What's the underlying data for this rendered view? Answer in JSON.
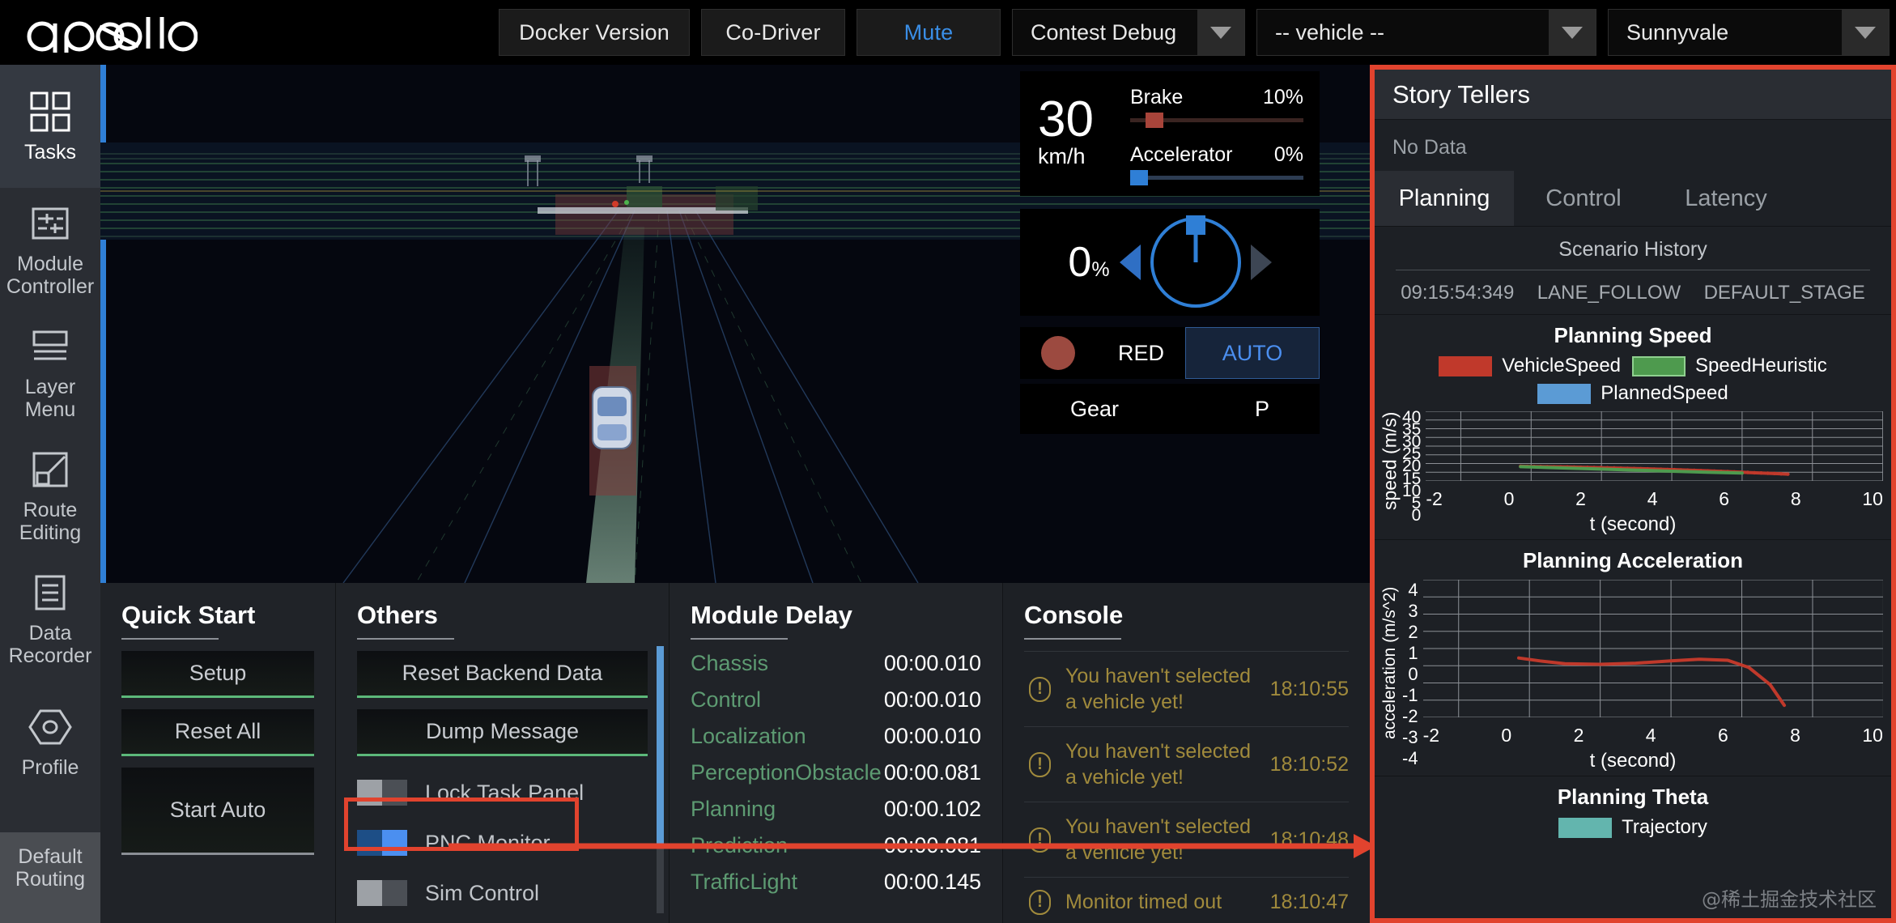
{
  "app": {
    "logo_text": "apollo"
  },
  "header": {
    "buttons": [
      {
        "label": "Docker Version",
        "accent": false
      },
      {
        "label": "Co-Driver",
        "accent": false
      },
      {
        "label": "Mute",
        "accent": true
      }
    ],
    "selects": [
      {
        "name": "mode-select",
        "value": "Contest Debug"
      },
      {
        "name": "vehicle-select",
        "value": "-- vehicle --"
      },
      {
        "name": "map-select",
        "value": "Sunnyvale"
      }
    ]
  },
  "sidebar": {
    "items": [
      {
        "label": "Tasks",
        "icon": "grid-icon",
        "active": true
      },
      {
        "label": "Module\nController",
        "icon": "sliders-icon",
        "active": false
      },
      {
        "label": "Layer\nMenu",
        "icon": "layers-icon",
        "active": false
      },
      {
        "label": "Route\nEditing",
        "icon": "route-icon",
        "active": false
      },
      {
        "label": "Data\nRecorder",
        "icon": "document-icon",
        "active": false
      },
      {
        "label": "Profile",
        "icon": "hexagon-eye-icon",
        "active": false
      }
    ],
    "bottom_item": {
      "label": "Default",
      "sub_label": "Routing"
    }
  },
  "hud": {
    "speed": {
      "value": "30",
      "unit": "km/h"
    },
    "brake": {
      "label": "Brake",
      "value": "10%",
      "percent": 10,
      "color": "#a8443a"
    },
    "accelerator": {
      "label": "Accelerator",
      "value": "0%",
      "percent": 0,
      "color": "#2f7fd6"
    },
    "steering": {
      "value": "0",
      "unit": "%"
    },
    "traffic_light": {
      "label": "RED",
      "color": "#9c4a40"
    },
    "drive_mode": {
      "label": "AUTO"
    },
    "gear": {
      "label": "Gear",
      "value": "P"
    }
  },
  "quick_start": {
    "title": "Quick Start",
    "buttons": [
      {
        "label": "Setup",
        "style": "green"
      },
      {
        "label": "Reset All",
        "style": "green"
      },
      {
        "label": "Start Auto",
        "style": "tall"
      }
    ]
  },
  "others": {
    "title": "Others",
    "buttons": [
      {
        "label": "Reset Backend Data"
      },
      {
        "label": "Dump Message"
      }
    ],
    "toggles": [
      {
        "label": "Lock Task Panel",
        "on": false,
        "highlighted": false
      },
      {
        "label": "PNC Monitor",
        "on": true,
        "highlighted": true
      },
      {
        "label": "Sim Control",
        "on": false,
        "highlighted": false
      }
    ]
  },
  "module_delay": {
    "title": "Module Delay",
    "rows": [
      {
        "name": "Chassis",
        "value": "00:00.010"
      },
      {
        "name": "Control",
        "value": "00:00.010"
      },
      {
        "name": "Localization",
        "value": "00:00.010"
      },
      {
        "name": "PerceptionObstacle",
        "value": "00:00.081"
      },
      {
        "name": "Planning",
        "value": "00:00.102"
      },
      {
        "name": "Prediction",
        "value": "00:00.081"
      },
      {
        "name": "TrafficLight",
        "value": "00:00.145"
      }
    ]
  },
  "console": {
    "title": "Console",
    "entries": [
      {
        "icon": "warning-icon",
        "message": "You haven't selected a vehicle yet!",
        "time": "18:10:55"
      },
      {
        "icon": "warning-icon",
        "message": "You haven't selected a vehicle yet!",
        "time": "18:10:52"
      },
      {
        "icon": "warning-icon",
        "message": "You haven't selected a vehicle yet!",
        "time": "18:10:48"
      },
      {
        "icon": "warning-icon",
        "message": "Monitor timed out",
        "time": "18:10:47"
      }
    ]
  },
  "pnc_monitor": {
    "title": "Story Tellers",
    "no_data": "No Data",
    "tabs": [
      {
        "label": "Planning",
        "active": true
      },
      {
        "label": "Control",
        "active": false
      },
      {
        "label": "Latency",
        "active": false
      }
    ],
    "scenario_history": {
      "title": "Scenario History",
      "row": [
        "09:15:54:349",
        "LANE_FOLLOW",
        "DEFAULT_STAGE"
      ]
    },
    "theta_title": "Planning Theta",
    "theta_legend": "Trajectory"
  },
  "chart_data": [
    {
      "type": "line",
      "title": "Planning Speed",
      "xlabel": "t (second)",
      "ylabel": "speed (m/s)",
      "xlim": [
        -3,
        10
      ],
      "ylim": [
        0,
        40
      ],
      "xticks": [
        "-2",
        "0",
        "2",
        "4",
        "6",
        "8",
        "10"
      ],
      "yticks": [
        "40",
        "35",
        "30",
        "25",
        "20",
        "15",
        "10",
        "5",
        "0"
      ],
      "grid": true,
      "legend_position": "top",
      "series": [
        {
          "name": "VehicleSpeed",
          "color": "#c0392b",
          "x": [
            -0.3,
            0,
            1,
            2,
            3,
            4,
            5,
            6,
            7,
            7.3
          ],
          "y": [
            8.4,
            8.3,
            8.0,
            7.6,
            7.1,
            6.5,
            5.8,
            5.0,
            4.2,
            3.9
          ]
        },
        {
          "name": "SpeedHeuristic",
          "color": "#4e9a4e",
          "x": [
            -0.3,
            0,
            1,
            2,
            3,
            4,
            5,
            6
          ],
          "y": [
            8.2,
            8.0,
            7.4,
            6.8,
            6.2,
            5.6,
            5.0,
            4.5
          ]
        },
        {
          "name": "PlannedSpeed",
          "color": "#5b9bd5",
          "x": [],
          "y": []
        }
      ]
    },
    {
      "type": "line",
      "title": "Planning Acceleration",
      "xlabel": "t (second)",
      "ylabel": "acceleration (m/s^2)",
      "xlim": [
        -3,
        10
      ],
      "ylim": [
        -4,
        4
      ],
      "xticks": [
        "-2",
        "0",
        "2",
        "4",
        "6",
        "8",
        "10"
      ],
      "yticks": [
        "4",
        "3",
        "2",
        "1",
        "0",
        "-1",
        "-2",
        "-3",
        "-4"
      ],
      "grid": true,
      "series": [
        {
          "name": "Trajectory",
          "color": "#c0392b",
          "x": [
            -0.3,
            0.3,
            1.0,
            2.0,
            3.0,
            4.0,
            4.8,
            5.6,
            6.2,
            6.8,
            7.2
          ],
          "y": [
            -0.55,
            -0.72,
            -0.88,
            -0.92,
            -0.85,
            -0.72,
            -0.62,
            -0.68,
            -1.1,
            -2.1,
            -3.3
          ]
        }
      ]
    }
  ],
  "watermark": "@稀土掘金技术社区"
}
